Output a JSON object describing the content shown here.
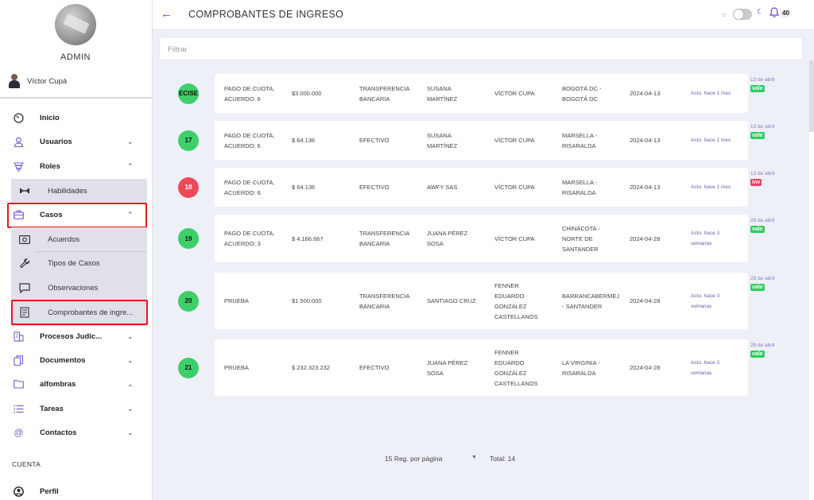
{
  "sidebar": {
    "admin_label": "ADMIN",
    "user_name": "Víctor Cupá",
    "nav": [
      {
        "label": "Inicio",
        "icon": "dashboard-gauge-icon",
        "chev": ""
      },
      {
        "label": "Usuarios",
        "icon": "user-icon",
        "chev": "⌄"
      },
      {
        "label": "Roles",
        "icon": "shield-icon",
        "chev": "⌃"
      }
    ],
    "roles_sub": [
      {
        "label": "Habilidades",
        "icon": "dumbbell-icon"
      }
    ],
    "casos": {
      "label": "Casos",
      "icon": "briefcase-icon",
      "chev": "⌃"
    },
    "casos_sub": [
      {
        "label": "Acuerdos",
        "icon": "money-icon"
      },
      {
        "label": "Tipos de Casos",
        "icon": "wrench-icon"
      },
      {
        "label": "Observaciones",
        "icon": "chat-icon"
      },
      {
        "label": "Comprobantes de ingre...",
        "icon": "receipt-icon"
      }
    ],
    "nav2": [
      {
        "label": "Procesos Judic...",
        "icon": "building-icon",
        "chev": "⌄"
      },
      {
        "label": "Documentos",
        "icon": "documents-icon",
        "chev": "⌄"
      },
      {
        "label": "alfombras",
        "icon": "folder-icon",
        "chev": "⌄"
      },
      {
        "label": "Tareas",
        "icon": "list-icon",
        "chev": "⌄"
      },
      {
        "label": "Contactos",
        "icon": "at-icon",
        "chev": "⌄"
      }
    ],
    "section_cuenta": "CUENTA",
    "perfil": {
      "label": "Perfil",
      "icon": "profile-icon"
    }
  },
  "header": {
    "title": "COMPROBANTES DE INGRESO",
    "notifications": "40"
  },
  "filter": {
    "placeholder": "Filtrar"
  },
  "records": [
    {
      "id": "ECISE",
      "id_color": "green",
      "concept": [
        "PAGO DE CUOTA,",
        "ACUERDO: 6"
      ],
      "amount": "$3.000.000",
      "method": [
        "TRANSFERENCIA",
        "BANCARIA"
      ],
      "payer": [
        "SUSANA",
        "MARTÍNEZ"
      ],
      "receiver": [
        "VÍCTOR CUPA"
      ],
      "location": [
        "BOGOTÁ DC -",
        "BOGOTÁ DC"
      ],
      "date": "2024-04-13",
      "updated": [
        "Acto. hace 1 mes"
      ],
      "side_date": "13 de abril",
      "tag": "vale",
      "tag_color": "green"
    },
    {
      "id": "17",
      "id_color": "green",
      "concept": [
        "PAGO DE CUOTA,",
        "ACUERDO: 6"
      ],
      "amount": "$ 64.136",
      "method": [
        "EFECTIVO"
      ],
      "payer": [
        "SUSANA",
        "MARTÍNEZ"
      ],
      "receiver": [
        "VÍCTOR CUPA"
      ],
      "location": [
        "MARSELLA -",
        "RISARALDA"
      ],
      "date": "2024-04-13",
      "updated": [
        "Acto. hace 1 mes"
      ],
      "side_date": "13 de abril",
      "tag": "vale",
      "tag_color": "green"
    },
    {
      "id": "18",
      "id_color": "red",
      "concept": [
        "PAGO DE CUOTA,",
        "ACUERDO: 6"
      ],
      "amount": "$ 64.136",
      "method": [
        "EFECTIVO"
      ],
      "payer": [
        "AWFY SAS"
      ],
      "receiver": [
        "VÍCTOR CUPA"
      ],
      "location": [
        "MARSELLA -",
        "RISARALDA"
      ],
      "date": "2024-04-13",
      "updated": [
        "Acto. hace 1 mes"
      ],
      "side_date": "13 de abril",
      "tag": "inv",
      "tag_color": "red"
    },
    {
      "id": "19",
      "id_color": "green",
      "concept": [
        "PAGO DE CUOTA,",
        "ACUERDO: 3"
      ],
      "amount": "$ 4.166.667",
      "method": [
        "TRANSFERENCIA",
        "BANCARIA"
      ],
      "payer": [
        "JUANA PÉREZ",
        "SOSA"
      ],
      "receiver": [
        "VÍCTOR CUPA"
      ],
      "location": [
        "CHINÁCOTA -",
        "NORTE DE",
        "SANTANDER"
      ],
      "date": "2024-04-28",
      "updated": [
        "Acto. hace 3",
        "semanas"
      ],
      "side_date": "28 de abril",
      "tag": "vale",
      "tag_color": "green"
    },
    {
      "id": "20",
      "id_color": "green",
      "concept": [
        "PRUEBA"
      ],
      "amount": "$1.500.000",
      "method": [
        "TRANSFERENCIA",
        "BANCARIA"
      ],
      "payer": [
        "SANTIAGO CRUZ"
      ],
      "receiver": [
        "FENNER",
        "EDUARDO",
        "GONZÁLEZ",
        "CASTELLANOS"
      ],
      "location": [
        "BARRANCABERMEJ",
        "- SANTANDER"
      ],
      "date": "2024-04-28",
      "updated": [
        "Acto. hace 3",
        "semanas"
      ],
      "side_date": "28 de abril",
      "tag": "vale",
      "tag_color": "green"
    },
    {
      "id": "21",
      "id_color": "green",
      "concept": [
        "PRUEBA"
      ],
      "amount": "$ 232.323.232",
      "method": [
        "EFECTIVO"
      ],
      "payer": [
        "JUANA PÉREZ",
        "SOSA"
      ],
      "receiver": [
        "FENNER",
        "EDUARDO",
        "GONZÁLEZ",
        "CASTELLANOS"
      ],
      "location": [
        "LA VIRGINIA -",
        "RISARALDA"
      ],
      "date": "2024-04-28",
      "updated": [
        "Acto. hace 3",
        "semanas"
      ],
      "side_date": "28 de abril",
      "tag": "vale",
      "tag_color": "green"
    }
  ],
  "pagination": {
    "per_page": "15 Reg. por página",
    "total": "Total: 14"
  },
  "colors": {
    "accent": "#6a3de8",
    "highlight_box": "#e51818",
    "green": "#3ecf6a",
    "red": "#ec4a5a"
  }
}
